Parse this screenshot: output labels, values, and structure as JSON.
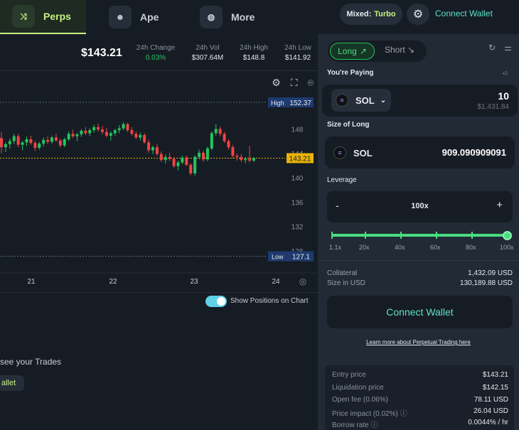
{
  "nav": {
    "tabs": [
      {
        "label": "Perps",
        "icon": "shuffle-icon"
      },
      {
        "label": "Ape",
        "icon": "ape-icon"
      },
      {
        "label": "More",
        "icon": "planet-icon"
      }
    ],
    "mixed_label": "Mixed:",
    "mixed_value": "Turbo",
    "connect_wallet": "Connect Wallet"
  },
  "stats": {
    "price": "$143.21",
    "items": [
      {
        "label": "24h Change",
        "value": "0.03%",
        "color": "#22c55e"
      },
      {
        "label": "24h Vol",
        "value": "$307.64M"
      },
      {
        "label": "24h High",
        "value": "$148.8"
      },
      {
        "label": "24h Low",
        "value": "$141.92"
      }
    ]
  },
  "chart_data": {
    "type": "candlestick",
    "x_labels": [
      "21",
      "22",
      "23",
      "24"
    ],
    "y_ticks": [
      148,
      144,
      140,
      136,
      132,
      128
    ],
    "ylim": [
      126,
      154
    ],
    "high_label": "High",
    "high_value": "152.37",
    "low_label": "Low",
    "low_value": "127.1",
    "current_value": "143.21",
    "up_color": "#22c55e",
    "down_color": "#ef4444",
    "candles": [
      [
        146.5,
        147.5,
        144.0,
        145.0
      ],
      [
        145.0,
        145.8,
        144.2,
        145.5
      ],
      [
        145.5,
        146.4,
        144.8,
        146.0
      ],
      [
        146.0,
        147.2,
        145.5,
        146.8
      ],
      [
        146.8,
        147.2,
        145.0,
        145.4
      ],
      [
        145.4,
        146.0,
        144.5,
        145.8
      ],
      [
        145.8,
        146.8,
        145.2,
        146.3
      ],
      [
        146.3,
        146.9,
        145.4,
        145.7
      ],
      [
        145.7,
        146.1,
        144.4,
        144.9
      ],
      [
        144.9,
        145.9,
        144.6,
        145.6
      ],
      [
        145.6,
        146.6,
        145.1,
        146.2
      ],
      [
        146.2,
        146.8,
        145.5,
        145.9
      ],
      [
        145.9,
        146.9,
        145.6,
        146.6
      ],
      [
        146.6,
        147.2,
        145.9,
        146.1
      ],
      [
        146.1,
        146.4,
        145.0,
        145.3
      ],
      [
        145.3,
        146.6,
        145.0,
        146.3
      ],
      [
        146.3,
        147.6,
        146.0,
        147.2
      ],
      [
        147.2,
        147.9,
        146.5,
        146.8
      ],
      [
        146.8,
        147.4,
        146.0,
        147.1
      ],
      [
        147.1,
        148.0,
        146.7,
        147.7
      ],
      [
        147.7,
        148.3,
        147.0,
        147.3
      ],
      [
        147.3,
        148.1,
        146.8,
        147.8
      ],
      [
        147.8,
        148.7,
        147.4,
        148.3
      ],
      [
        148.3,
        148.9,
        147.6,
        147.9
      ],
      [
        147.9,
        148.5,
        147.1,
        147.5
      ],
      [
        147.5,
        148.2,
        146.6,
        146.9
      ],
      [
        146.9,
        147.6,
        146.1,
        147.3
      ],
      [
        147.3,
        148.0,
        146.9,
        147.8
      ],
      [
        147.8,
        148.6,
        147.3,
        148.1
      ],
      [
        148.1,
        149.1,
        147.8,
        148.8
      ],
      [
        148.8,
        149.0,
        147.5,
        147.8
      ],
      [
        147.8,
        148.3,
        146.9,
        147.2
      ],
      [
        147.2,
        147.6,
        146.3,
        146.6
      ],
      [
        146.6,
        147.4,
        146.1,
        147.0
      ],
      [
        147.0,
        147.3,
        145.6,
        145.8
      ],
      [
        145.8,
        146.2,
        144.1,
        144.5
      ],
      [
        144.5,
        145.3,
        143.9,
        145.0
      ],
      [
        145.0,
        145.5,
        143.6,
        143.9
      ],
      [
        143.9,
        144.3,
        142.6,
        142.9
      ],
      [
        142.9,
        143.8,
        142.3,
        143.4
      ],
      [
        143.4,
        144.1,
        142.7,
        143.1
      ],
      [
        143.1,
        143.4,
        141.6,
        141.9
      ],
      [
        141.9,
        142.8,
        141.2,
        142.5
      ],
      [
        142.5,
        143.6,
        142.2,
        143.3
      ],
      [
        143.3,
        143.6,
        141.9,
        142.1
      ],
      [
        142.1,
        142.4,
        140.4,
        140.7
      ],
      [
        140.7,
        143.7,
        140.3,
        143.4
      ],
      [
        143.4,
        144.6,
        143.0,
        144.1
      ],
      [
        144.1,
        144.4,
        142.6,
        143.0
      ],
      [
        143.0,
        145.1,
        142.7,
        144.8
      ],
      [
        144.8,
        147.6,
        144.5,
        147.3
      ],
      [
        147.3,
        148.8,
        146.9,
        148.0
      ],
      [
        148.0,
        148.4,
        146.8,
        147.2
      ],
      [
        147.2,
        147.5,
        145.7,
        146.0
      ],
      [
        146.0,
        146.3,
        144.6,
        145.0
      ],
      [
        145.0,
        145.4,
        143.2,
        143.6
      ],
      [
        143.6,
        144.0,
        142.8,
        143.4
      ],
      [
        143.4,
        143.9,
        142.6,
        142.9
      ],
      [
        142.9,
        143.4,
        142.4,
        143.1
      ],
      [
        143.1,
        145.2,
        142.5,
        142.8
      ],
      [
        142.8,
        143.4,
        142.6,
        143.2
      ]
    ]
  },
  "below_chart": {
    "show_positions": "Show Positions on Chart",
    "see_trades": "see your Trades",
    "wallet_fragment": "allet"
  },
  "panel": {
    "long_label": "Long",
    "short_label": "Short",
    "paying_label": "You're Paying",
    "pay_token": "SOL",
    "pay_amount": "10",
    "pay_usd": "$1,431.84",
    "size_label": "Size of Long",
    "size_token": "SOL",
    "size_value": "909.090909091",
    "leverage_label": "Leverage",
    "leverage_minus": "-",
    "leverage_value": "100x",
    "leverage_plus": "+",
    "leverage_level": 1.0,
    "slider_labels": [
      "1.1x",
      "20x",
      "40x",
      "60x",
      "80x",
      "100x"
    ],
    "collateral_label": "Collateral",
    "collateral_value": "1,432.09 USD",
    "size_usd_label": "Size in USD",
    "size_usd_value": "130,189.88 USD",
    "connect_wallet": "Connect Wallet",
    "learn_more": "Learn more about Perpetual Trading here",
    "info": [
      {
        "label": "Entry price",
        "value": "$143.21"
      },
      {
        "label": "Liquidation price",
        "value": "$142.15"
      },
      {
        "label": "Open fee (0.06%)",
        "value": "78.11 USD"
      },
      {
        "label": "Price impact (0.02%) ⓘ",
        "value": "26.04 USD"
      },
      {
        "label": "Borrow rate ⓘ",
        "value": "0.0044% / hr"
      }
    ]
  }
}
